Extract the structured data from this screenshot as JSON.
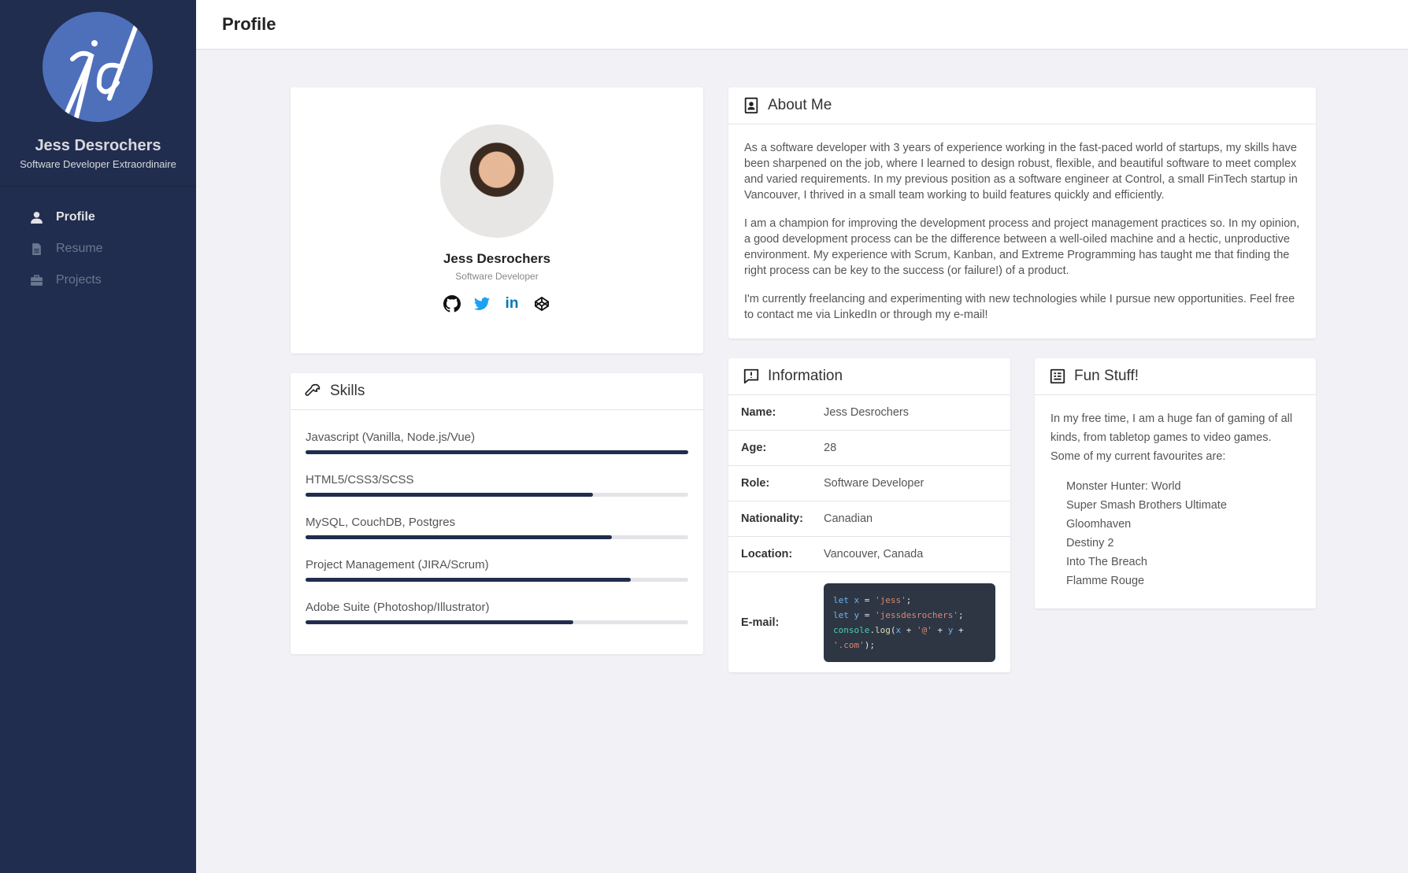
{
  "sidebar": {
    "name": "Jess Desrochers",
    "tagline": "Software Developer Extraordinaire",
    "logo_text": "jd",
    "nav": [
      {
        "label": "Profile",
        "icon": "user-icon"
      },
      {
        "label": "Resume",
        "icon": "file-icon"
      },
      {
        "label": "Projects",
        "icon": "briefcase-icon"
      }
    ]
  },
  "header": {
    "title": "Profile"
  },
  "profile": {
    "name": "Jess Desrochers",
    "role": "Software Developer",
    "socials": [
      "github",
      "twitter",
      "linkedin",
      "codepen"
    ],
    "linkedin_text": "in",
    "twitter_color": "#1da1f2",
    "linkedin_color": "#0077b5"
  },
  "skills": {
    "title": "Skills",
    "items": [
      {
        "label": "Javascript (Vanilla, Node.js/Vue)",
        "percent": 100
      },
      {
        "label": "HTML5/CSS3/SCSS",
        "percent": 75
      },
      {
        "label": "MySQL, CouchDB, Postgres",
        "percent": 80
      },
      {
        "label": "Project Management (JIRA/Scrum)",
        "percent": 85
      },
      {
        "label": "Adobe Suite (Photoshop/Illustrator)",
        "percent": 70
      }
    ]
  },
  "about": {
    "title": "About Me",
    "paragraphs": [
      "As a software developer with 3 years of experience working in the fast-paced world of startups, my skills have been sharpened on the job, where I learned to design robust, flexible, and beautiful software to meet complex and varied requirements. In my previous position as a software engineer at Control, a small FinTech startup in Vancouver, I thrived in a small team working to build features quickly and efficiently.",
      "I am a champion for improving the development process and project management practices so. In my opinion, a good development process can be the difference between a well-oiled machine and a hectic, unproductive environment. My experience with Scrum, Kanban, and Extreme Programming has taught me that finding the right process can be key to the success (or failure!) of a product.",
      "I'm currently freelancing and experimenting with new technologies while I pursue new opportunities. Feel free to contact me via LinkedIn or through my e-mail!"
    ]
  },
  "info": {
    "title": "Information",
    "rows": [
      {
        "key": "Name:",
        "value": "Jess Desrochers"
      },
      {
        "key": "Age:",
        "value": "28"
      },
      {
        "key": "Role:",
        "value": "Software Developer"
      },
      {
        "key": "Nationality:",
        "value": "Canadian"
      },
      {
        "key": "Location:",
        "value": "Vancouver, Canada"
      }
    ],
    "email_label": "E-mail:",
    "code": {
      "let": "let",
      "x": "x",
      "y": "y",
      "eq": "=",
      "semi": ";",
      "s1": "'jess'",
      "s2": "'jessdesrochers'",
      "console": "console",
      "log": "log",
      "open": "(",
      "plus": "+",
      "at": "'@'",
      "com": "'.com'",
      "close": ");"
    }
  },
  "fun": {
    "title": "Fun Stuff!",
    "intro": "In my free time, I am a huge fan of gaming of all kinds, from tabletop games to video games. Some of my current favourites are:",
    "games": [
      "Monster Hunter: World",
      "Super Smash Brothers Ultimate",
      "Gloomhaven",
      "Destiny 2",
      "Into The Breach",
      "Flamme Rouge"
    ]
  }
}
